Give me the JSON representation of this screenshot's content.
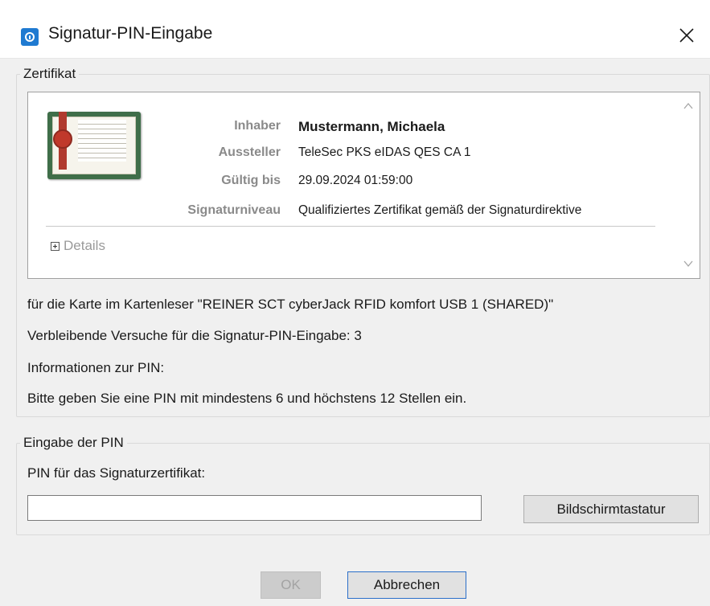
{
  "window": {
    "title": "Signatur-PIN-Eingabe",
    "icon": "app-shield-icon"
  },
  "certificate": {
    "group_label": "Zertifikat",
    "fields": [
      {
        "label": "Inhaber",
        "value": "Mustermann, Michaela"
      },
      {
        "label": "Aussteller",
        "value": "TeleSec PKS eIDAS QES CA 1"
      },
      {
        "label": "Gültig bis",
        "value": "29.09.2024 01:59:00"
      },
      {
        "label": "Signaturniveau",
        "value": "Qualifiziertes Zertifikat gemäß der Signaturdirektive"
      }
    ],
    "details_label": "Details"
  },
  "info": {
    "card_reader": "für die Karte im Kartenleser \"REINER SCT cyberJack RFID komfort USB 1 (SHARED)\"",
    "remaining_attempts": "Verbleibende Versuche für die Signatur-PIN-Eingabe: 3",
    "pin_info_heading": "Informationen zur PIN:",
    "pin_rules": "Bitte geben Sie eine PIN mit mindestens 6 und höchstens 12 Stellen ein."
  },
  "pin_entry": {
    "group_label": "Eingabe der PIN",
    "field_label": "PIN für das Signaturzertifikat:",
    "value": "",
    "keyboard_button": "Bildschirmtastatur"
  },
  "buttons": {
    "ok": "OK",
    "cancel": "Abbrechen"
  },
  "colors": {
    "accent": "#1f7ad1",
    "label_gray": "#8a8a8a",
    "window_bg": "#f0f0f0"
  }
}
